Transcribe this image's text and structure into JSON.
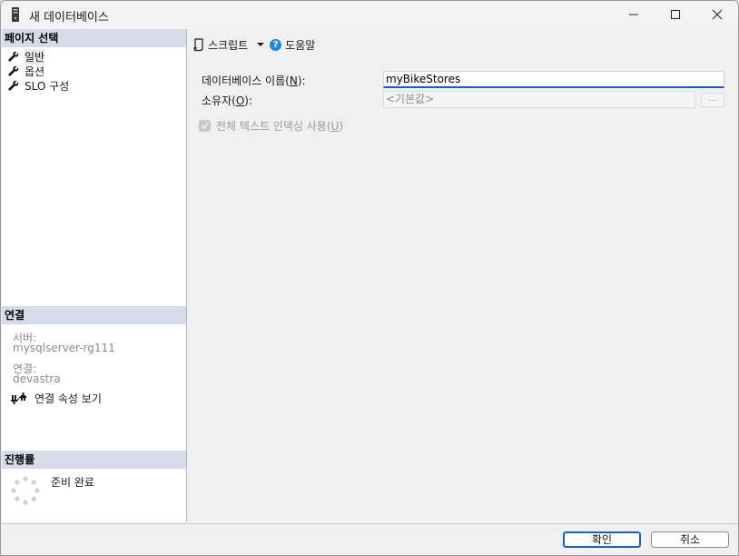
{
  "window": {
    "title": "새 데이터베이스"
  },
  "left": {
    "select_page_header": "페이지 선택",
    "pages": [
      {
        "label": "일반"
      },
      {
        "label": "옵션"
      },
      {
        "label": "SLO 구성"
      }
    ],
    "connection_header": "연결",
    "server_label": "서버:",
    "server_value": "mysqlserver-rg111",
    "connection_label": "연결:",
    "connection_value": "devastra",
    "view_connection_properties": "연결 속성 보기",
    "progress_header": "진행률",
    "progress_status": "준비 완료"
  },
  "toolbar": {
    "script_label": "스크립트",
    "help_label": "도움말"
  },
  "form": {
    "db_name_label_pre": "데이터베이스 이름(",
    "db_name_label_key": "N",
    "db_name_label_post": "):",
    "db_name_value": "myBikeStores",
    "owner_label_pre": "소유자(",
    "owner_label_key": "O",
    "owner_label_post": "):",
    "owner_value": "<기본값>",
    "browse_label": "...",
    "fts_label_pre": "전체 텍스트 인덱싱 사용(",
    "fts_label_key": "U",
    "fts_label_post": ")"
  },
  "buttons": {
    "ok": "확인",
    "cancel": "취소"
  },
  "colors": {
    "section_header": "#d6dbe9",
    "accent": "#1a5fb4",
    "help_icon": "#1e88d8"
  }
}
